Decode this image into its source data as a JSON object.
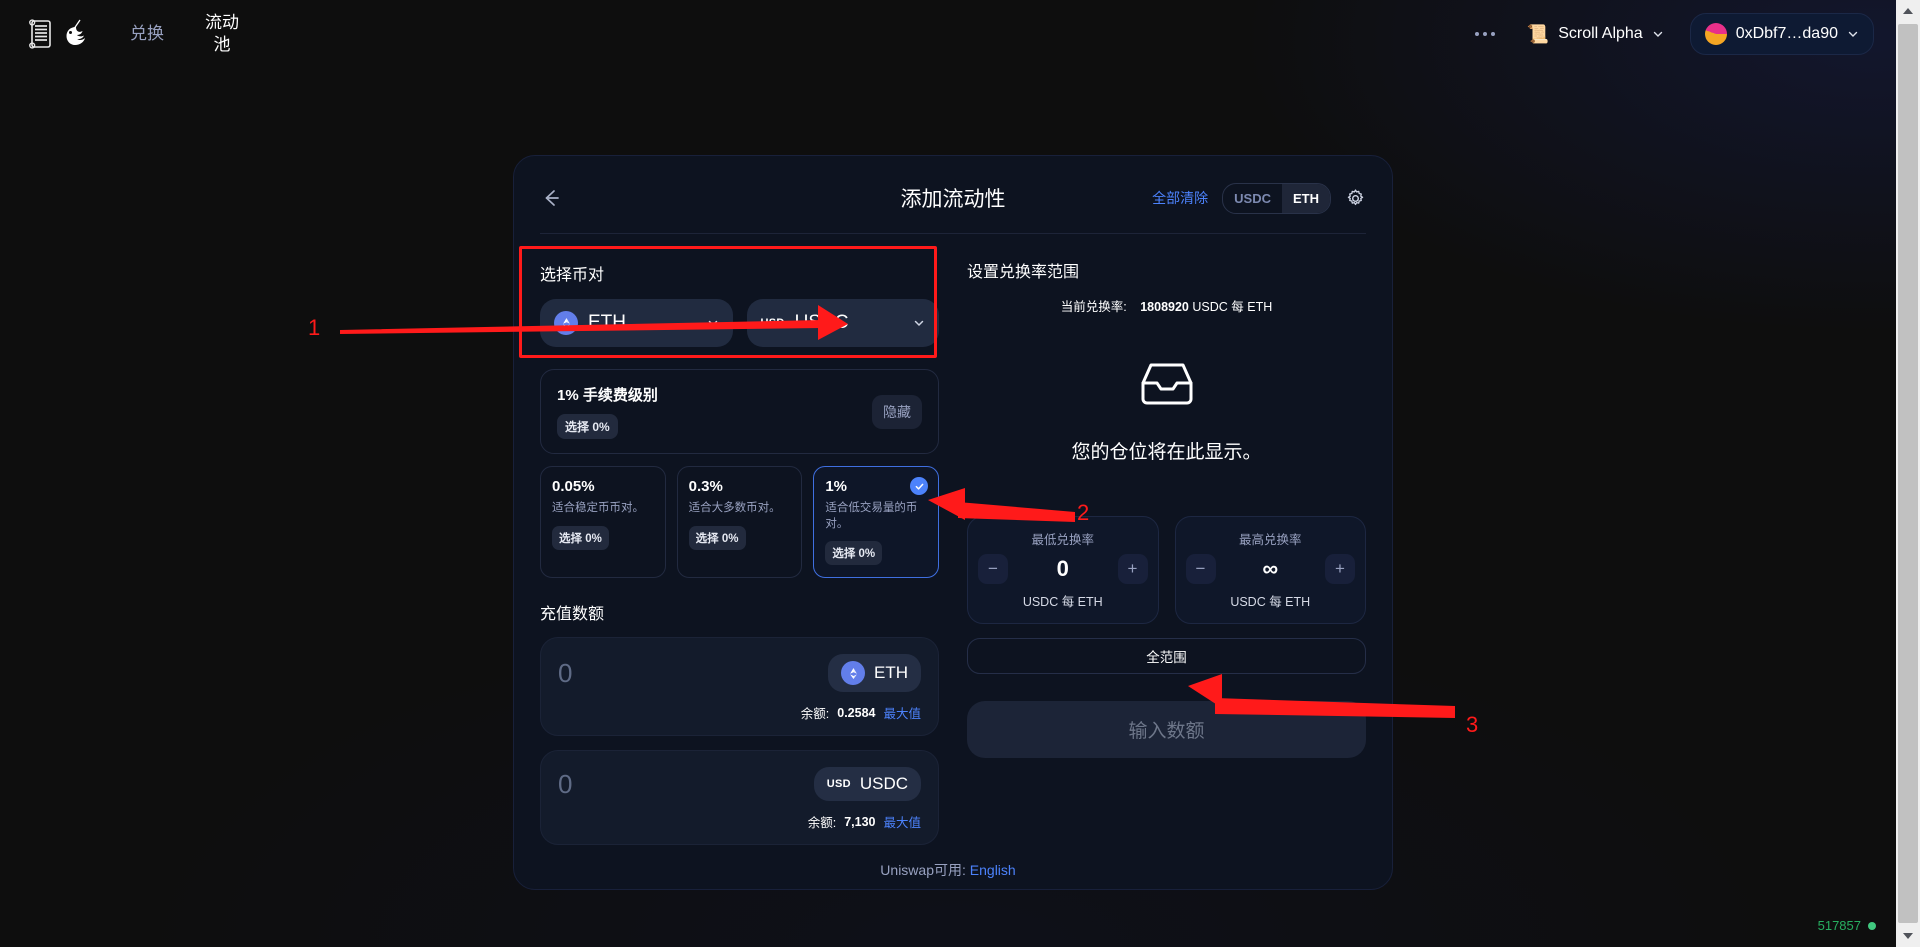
{
  "header": {
    "logo_name": "uniswap-scroll-logo",
    "nav": [
      {
        "label": "兑换",
        "active": false
      },
      {
        "label": "流动\n池",
        "label_line1": "流动",
        "label_line2": "池",
        "active": true
      }
    ],
    "more_label": "more-dots",
    "chain": {
      "icon": "📜",
      "label": "Scroll Alpha"
    },
    "account": {
      "label": "0xDbf7…da90"
    }
  },
  "card": {
    "back_icon": "back-arrow-icon",
    "title": "添加流动性",
    "clear_all": "全部清除",
    "token_toggle": {
      "left": "USDC",
      "right": "ETH",
      "selected": "ETH"
    },
    "settings_icon": "gear-icon"
  },
  "pair": {
    "section_title": "选择币对",
    "token_a": {
      "symbol": "ETH",
      "icon": "eth-logo"
    },
    "token_b": {
      "symbol": "USDC",
      "icon": "usd-logo",
      "prefix": "USD"
    }
  },
  "fee": {
    "header_title": "1% 手续费级别",
    "header_badge": "选择 0%",
    "hide_button": "隐藏",
    "tiers": [
      {
        "pct": "0.05%",
        "desc": "适合稳定币币对。",
        "badge": "选择 0%",
        "selected": false
      },
      {
        "pct": "0.3%",
        "desc": "适合大多数币对。",
        "badge": "选择 0%",
        "selected": false
      },
      {
        "pct": "1%",
        "desc": "适合低交易量的币对。",
        "badge": "选择 0%",
        "selected": true
      }
    ]
  },
  "deposit": {
    "section_title": "充值数额",
    "inputs": [
      {
        "value": "0",
        "placeholder": "0",
        "token": "ETH",
        "balance_label": "余额:",
        "balance_value": "0.2584",
        "max_label": "最大值"
      },
      {
        "value": "0",
        "placeholder": "0",
        "token": "USDC",
        "token_prefix": "USD",
        "balance_label": "余额:",
        "balance_value": "7,130",
        "max_label": "最大值"
      }
    ]
  },
  "range": {
    "section_title": "设置兑换率范围",
    "current_rate_label": "当前兑换率:",
    "current_rate_value": "1808920",
    "current_rate_unit": "USDC 每 ETH",
    "empty_icon": "inbox-icon",
    "empty_text": "您的仓位将在此显示。",
    "min": {
      "label": "最低兑换率",
      "value": "0",
      "unit": "USDC 每 ETH",
      "decrement": "−",
      "increment": "+"
    },
    "max": {
      "label": "最高兑换率",
      "value": "∞",
      "unit": "USDC 每 ETH",
      "decrement": "−",
      "increment": "+"
    },
    "full_range_button": "全范围",
    "submit_button": "输入数额"
  },
  "footer": {
    "text": "Uniswap可用:",
    "language_link": "English"
  },
  "status": {
    "block_number": "517857"
  },
  "annotations": {
    "accent_color": "#ff1a1a",
    "markers": [
      {
        "number": "1",
        "target": "token-pair-selector"
      },
      {
        "number": "2",
        "target": "fee-tier-1-percent"
      },
      {
        "number": "3",
        "target": "full-range-button"
      }
    ]
  }
}
